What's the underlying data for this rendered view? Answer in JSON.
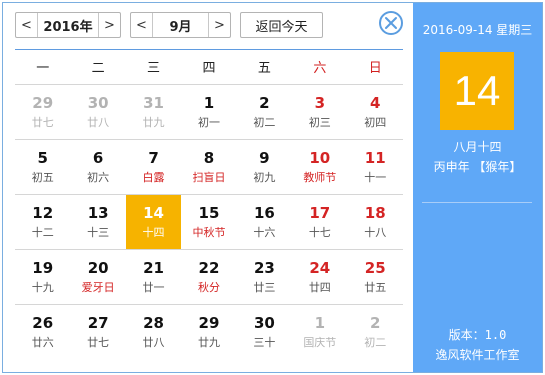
{
  "toolbar": {
    "prev": "<",
    "next": ">",
    "year": "2016年",
    "month": "9月",
    "today_label": "返回今天"
  },
  "weekdays": [
    "一",
    "二",
    "三",
    "四",
    "五",
    "六",
    "日"
  ],
  "weeks": [
    [
      {
        "day": "29",
        "sub": "廿七",
        "other": true
      },
      {
        "day": "30",
        "sub": "廿八",
        "other": true
      },
      {
        "day": "31",
        "sub": "廿九",
        "other": true
      },
      {
        "day": "1",
        "sub": "初一"
      },
      {
        "day": "2",
        "sub": "初二"
      },
      {
        "day": "3",
        "sub": "初三",
        "weekend": true
      },
      {
        "day": "4",
        "sub": "初四",
        "weekend": true
      }
    ],
    [
      {
        "day": "5",
        "sub": "初五"
      },
      {
        "day": "6",
        "sub": "初六"
      },
      {
        "day": "7",
        "sub": "白露",
        "festival": true
      },
      {
        "day": "8",
        "sub": "扫盲日",
        "festival": true
      },
      {
        "day": "9",
        "sub": "初九"
      },
      {
        "day": "10",
        "sub": "教师节",
        "weekend": true,
        "festival": true
      },
      {
        "day": "11",
        "sub": "十一",
        "weekend": true
      }
    ],
    [
      {
        "day": "12",
        "sub": "十二"
      },
      {
        "day": "13",
        "sub": "十三"
      },
      {
        "day": "14",
        "sub": "十四",
        "selected": true
      },
      {
        "day": "15",
        "sub": "中秋节",
        "festival": true
      },
      {
        "day": "16",
        "sub": "十六"
      },
      {
        "day": "17",
        "sub": "十七",
        "weekend": true
      },
      {
        "day": "18",
        "sub": "十八",
        "weekend": true
      }
    ],
    [
      {
        "day": "19",
        "sub": "十九"
      },
      {
        "day": "20",
        "sub": "爱牙日",
        "festival": true
      },
      {
        "day": "21",
        "sub": "廿一"
      },
      {
        "day": "22",
        "sub": "秋分",
        "festival": true
      },
      {
        "day": "23",
        "sub": "廿三"
      },
      {
        "day": "24",
        "sub": "廿四",
        "weekend": true
      },
      {
        "day": "25",
        "sub": "廿五",
        "weekend": true
      }
    ],
    [
      {
        "day": "26",
        "sub": "廿六"
      },
      {
        "day": "27",
        "sub": "廿七"
      },
      {
        "day": "28",
        "sub": "廿八"
      },
      {
        "day": "29",
        "sub": "廿九"
      },
      {
        "day": "30",
        "sub": "三十"
      },
      {
        "day": "1",
        "sub": "国庆节",
        "other": true
      },
      {
        "day": "2",
        "sub": "初二",
        "other": true
      }
    ]
  ],
  "side": {
    "date_line": "2016-09-14 星期三",
    "big_day": "14",
    "lunar": "八月十四",
    "ganzhi": "丙申年 【猴年】",
    "version": "版本：1.0",
    "studio": "逸风软件工作室"
  },
  "colors": {
    "accent": "#5fa8f7",
    "selected": "#f6b300",
    "weekend": "#d42424",
    "other_month": "#b3b3b3"
  }
}
